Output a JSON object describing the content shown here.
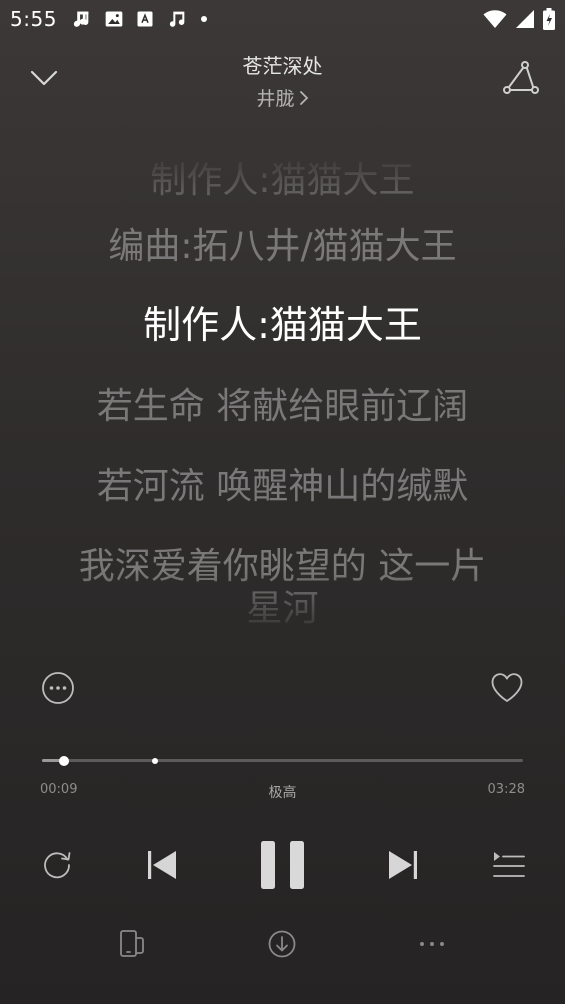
{
  "status": {
    "time": "5:55",
    "left_icons": [
      "music-note-icon",
      "image-icon",
      "font-icon",
      "music-note-icon",
      "dot-icon"
    ],
    "right_icons": [
      "wifi-icon",
      "signal-icon",
      "battery-charging-icon"
    ]
  },
  "header": {
    "title": "苍茫深处",
    "artist": "井胧",
    "collapse_icon": "chevron-down-icon",
    "share_icon": "share-icon"
  },
  "lyrics": [
    {
      "text": "制作人:猫猫大王",
      "state": "past"
    },
    {
      "text": "编曲:拓八井/猫猫大王",
      "state": "past"
    },
    {
      "text": "制作人:猫猫大王",
      "state": "current"
    },
    {
      "text": "若生命 将献给眼前辽阔",
      "state": "upcoming"
    },
    {
      "text": "若河流 唤醒神山的缄默",
      "state": "upcoming"
    },
    {
      "text": "我深爱着你眺望的 这一片星河",
      "state": "upcoming"
    }
  ],
  "actions": {
    "more_icon": "more-circle-icon",
    "like_icon": "heart-icon"
  },
  "progress": {
    "elapsed": "00:09",
    "total": "03:28",
    "played_fraction": 0.045,
    "buffer_mark_fraction": 0.235,
    "quality": "极高"
  },
  "controls": {
    "repeat_icon": "repeat-icon",
    "prev_icon": "skip-previous-icon",
    "pause_icon": "pause-icon",
    "next_icon": "skip-next-icon",
    "playlist_icon": "playlist-icon"
  },
  "bottom": {
    "device_icon": "device-icon",
    "download_icon": "download-icon",
    "overflow_icon": "more-horizontal-icon"
  },
  "colors": {
    "background_top": "#3c3838",
    "background_bottom": "#252323",
    "lyric_current": "#ffffff",
    "lyric_dim": "#7a7878"
  }
}
